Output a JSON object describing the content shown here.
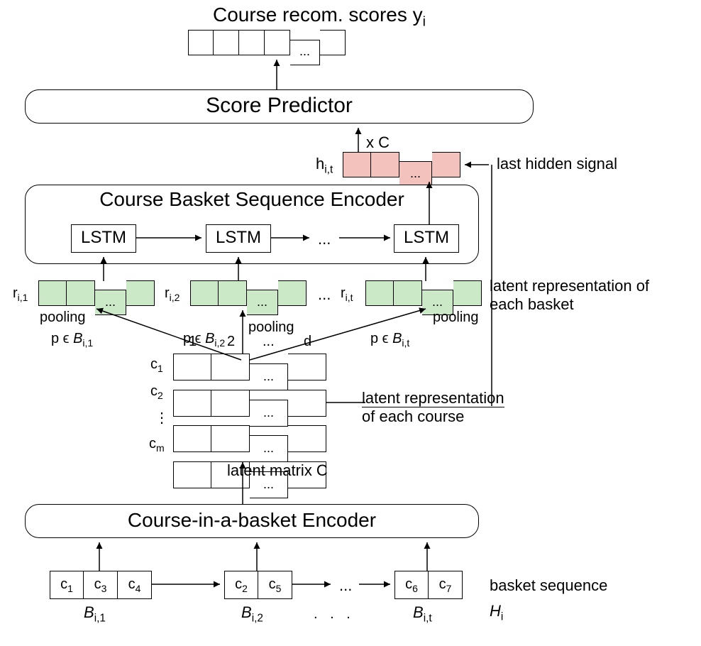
{
  "title": "Course recom. scores y",
  "title_sub": "i",
  "score_predictor": "Score Predictor",
  "seq_encoder": "Course Basket Sequence Encoder",
  "lstm": "LSTM",
  "basket_encoder": "Course-in-a-basket Encoder",
  "h_label": "h",
  "h_sub": "i,t",
  "xC": "x  C",
  "last_hidden": "last hidden signal",
  "r_labels": {
    "r1": "r",
    "r1s": "i,1",
    "r2": "r",
    "r2s": "i,2",
    "rt": "r",
    "rts": "i,t"
  },
  "latent_basket": "latent representation of each basket",
  "pooling": "pooling",
  "p_in": "p ϵ ",
  "B": "B",
  "B1s": "i,1",
  "B2s": "i,2",
  "Bts": "i,t",
  "cols": {
    "c1": "1",
    "c2": "2",
    "c3": "...",
    "cd": "d"
  },
  "rows": {
    "c1": "c",
    "c1s": "1",
    "c2": "c",
    "c2s": "2",
    "dots": "⋮",
    "cm": "c",
    "cms": "m"
  },
  "latent_course": "latent representation of each course",
  "latent_matrix": "latent matrix C",
  "baskets": {
    "b1": [
      "c",
      "1",
      "c",
      "3",
      "c",
      "4"
    ],
    "b2": [
      "c",
      "2",
      "c",
      "5"
    ],
    "b3": [
      "c",
      "6",
      "c",
      "7"
    ]
  },
  "basket_seq": "basket sequence",
  "H": "H",
  "Hs": "i",
  "dots": "...",
  "ellipsis3": ". . ."
}
